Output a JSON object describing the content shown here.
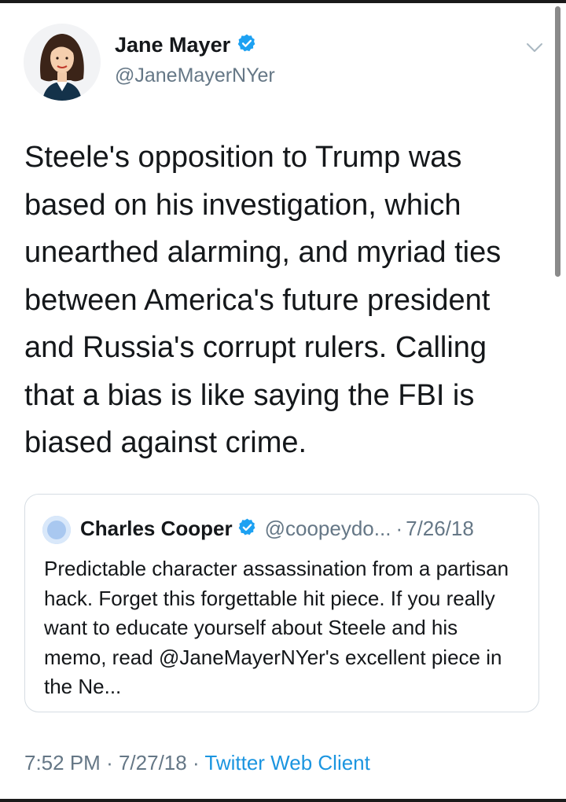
{
  "tweet": {
    "author_name": "Jane Mayer",
    "handle": "@JaneMayerNYer",
    "verified_icon": "verified-badge-icon",
    "text": "Steele's opposition to Trump was based on his investigation, which unearthed alarming, and myriad ties between America's future president and Russia's corrupt rulers. Calling that a bias is like saying the FBI is biased against crime.",
    "time": "7:52 PM",
    "date": "7/27/18",
    "separator": "·",
    "client": "Twitter Web Client"
  },
  "quoted_tweet": {
    "author_name": "Charles Cooper",
    "handle": "@coopeydo...",
    "separator": "·",
    "date": "7/26/18",
    "text": "Predictable character assassination from a partisan hack. Forget this forgettable hit piece. If you really want to educate yourself about Steele and his memo, read @JaneMayerNYer's excellent piece in the Ne..."
  },
  "colors": {
    "text": "#14171a",
    "secondary": "#657786",
    "link": "#1b95e0",
    "verified": "#1da1f2",
    "border": "#d6dde3"
  }
}
